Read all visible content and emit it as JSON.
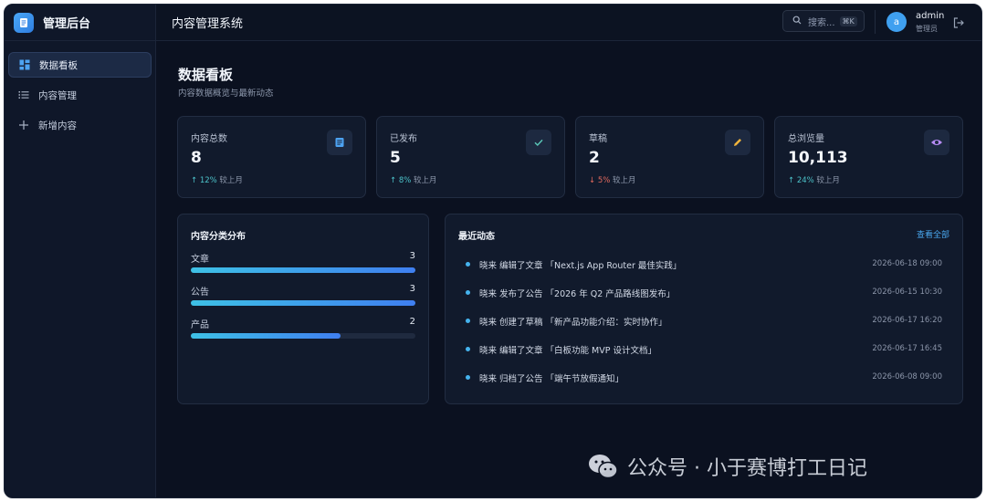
{
  "brand": {
    "title": "管理后台",
    "logo_icon": "document-icon",
    "accent": "#3b8fec"
  },
  "sidebar": {
    "items": [
      {
        "label": "数据看板",
        "icon": "dashboard-icon",
        "active": true
      },
      {
        "label": "内容管理",
        "icon": "list-icon",
        "active": false
      },
      {
        "label": "新增内容",
        "icon": "plus-icon",
        "active": false
      }
    ]
  },
  "header": {
    "title": "内容管理系统",
    "search_placeholder": "搜索...",
    "search_shortcut": "⌘K",
    "user": {
      "avatar_letter": "a",
      "name": "admin",
      "role": "管理员"
    }
  },
  "page": {
    "title": "数据看板",
    "subtitle": "内容数据概览与最新动态"
  },
  "stats": [
    {
      "label": "内容总数",
      "value": "8",
      "direction": "up",
      "trend": "↑ 12%",
      "trend_suffix": "较上月",
      "icon": "document-icon",
      "icon_color": "#4da3f2"
    },
    {
      "label": "已发布",
      "value": "5",
      "direction": "up",
      "trend": "↑ 8%",
      "trend_suffix": "较上月",
      "icon": "check-icon",
      "icon_color": "#5ac8b8"
    },
    {
      "label": "草稿",
      "value": "2",
      "direction": "down",
      "trend": "↓ 5%",
      "trend_suffix": "较上月",
      "icon": "pencil-icon",
      "icon_color": "#f1b43c"
    },
    {
      "label": "总浏览量",
      "value": "10,113",
      "direction": "up",
      "trend": "↑ 24%",
      "trend_suffix": "较上月",
      "icon": "eye-icon",
      "icon_color": "#b78cf5"
    }
  ],
  "category_panel": {
    "title": "内容分类分布",
    "max": 3,
    "items": [
      {
        "label": "文章",
        "count": 3
      },
      {
        "label": "公告",
        "count": 3
      },
      {
        "label": "产品",
        "count": 2
      }
    ]
  },
  "activity_panel": {
    "title": "最近动态",
    "view_all": "查看全部",
    "items": [
      {
        "text": "晓来 编辑了文章 「Next.js App Router 最佳实践」",
        "time": "2026-06-18 09:00"
      },
      {
        "text": "晓来 发布了公告 「2026 年 Q2 产品路线图发布」",
        "time": "2026-06-15 10:30"
      },
      {
        "text": "晓来 创建了草稿 「新产品功能介绍：实时协作」",
        "time": "2026-06-17 16:20"
      },
      {
        "text": "晓来 编辑了文章 「白板功能 MVP 设计文档」",
        "time": "2026-06-17 16:45"
      },
      {
        "text": "晓来 归档了公告 「端午节放假通知」",
        "time": "2026-06-08 09:00"
      }
    ]
  },
  "watermark": {
    "text": "公众号 · 小于赛博打工日记",
    "icon": "wechat-icon"
  }
}
